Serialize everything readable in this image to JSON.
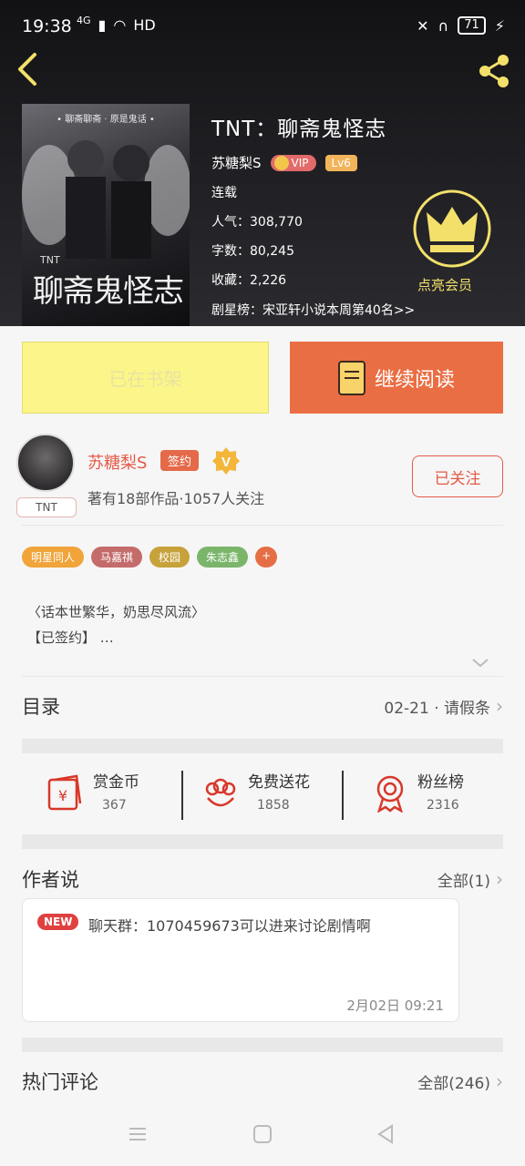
{
  "status": {
    "time": "19:38",
    "network": "4G",
    "hd": "HD",
    "battery": "71"
  },
  "book": {
    "title": "TNT：聊斋鬼怪志",
    "cover_top_text": "• 聊斋聊斋 · 原是鬼话 •",
    "cover_sub": "TNT",
    "cover_title": "聊斋鬼怪志",
    "author": "苏糖梨S",
    "vip": "VIP",
    "level": "Lv6",
    "status": "连载",
    "popularity": "人气：308,770",
    "word_count": "字数：80,245",
    "favorites": "收藏：2,226",
    "rank": "剧星榜：宋亚轩小说本周第40名>>"
  },
  "vip_promo": {
    "label": "点亮会员"
  },
  "actions": {
    "shelf_label": "已在书架",
    "read_label": "继续阅读"
  },
  "author_card": {
    "name": "苏糖梨S",
    "sign_badge": "签约",
    "avatar_tag": "TNT",
    "desc": "著有18部作品·1057人关注",
    "follow_label": "已关注"
  },
  "tags": [
    {
      "label": "明星同人",
      "color": "#f0a43a"
    },
    {
      "label": "马嘉祺",
      "color": "#c46b6b"
    },
    {
      "label": "校园",
      "color": "#c7a23a"
    },
    {
      "label": "朱志鑫",
      "color": "#7ab56a"
    },
    {
      "label": "+",
      "color": "#e56e45"
    }
  ],
  "intro": {
    "line1": "〈话本世繁华，奶思尽风流〉",
    "line2": "【已签约】 …"
  },
  "toc": {
    "title": "目录",
    "latest": "02-21 · 请假条"
  },
  "stats": [
    {
      "name": "赏金币",
      "value": "367",
      "icon": "coin-pouch-icon"
    },
    {
      "name": "免费送花",
      "value": "1858",
      "icon": "flower-icon"
    },
    {
      "name": "粉丝榜",
      "value": "2316",
      "icon": "medal-icon"
    }
  ],
  "author_notes": {
    "title": "作者说",
    "all": "全部(1)",
    "badge": "NEW",
    "text": "聊天群：1070459673可以进来讨论剧情啊",
    "time": "2月02日  09:21"
  },
  "comments": {
    "title": "热门评论",
    "all": "全部(246)"
  },
  "colors": {
    "accent": "#ea6e43",
    "shelf": "#fbf58a",
    "author_red": "#e45a48",
    "vip_gold": "#f3e06a"
  }
}
